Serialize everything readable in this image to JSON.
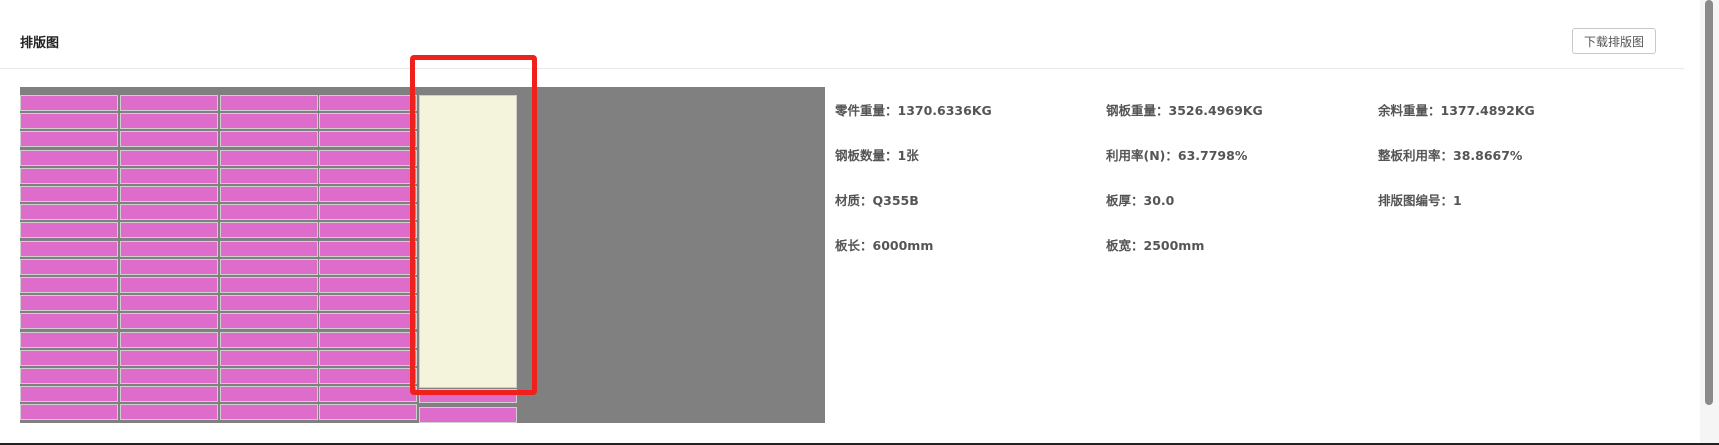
{
  "panel": {
    "title": "排版图",
    "download_label": "下载排版图"
  },
  "info": {
    "parts_weight": "零件重量：1370.6336KG",
    "plate_weight": "钢板重量：3526.4969KG",
    "remnant_weight": "余料重量：1377.4892KG",
    "plate_count": "钢板数量：1张",
    "utilization_n": "利用率(N)：63.7798%",
    "whole_plate_utilization": "整板利用率：38.8667%",
    "material": "材质：Q355B",
    "thickness": "板厚：30.0",
    "layout_number": "排版图编号：1",
    "plate_length": "板长：6000mm",
    "plate_width": "板宽：2500mm"
  },
  "layout": {
    "plate_color": "#808080",
    "part_color": "#dd6ccb",
    "remnant_color": "#f4f3dc",
    "highlight_color": "#f0201c",
    "full_part_columns": 4,
    "rows": 18,
    "fifth_column_parts": 2
  }
}
